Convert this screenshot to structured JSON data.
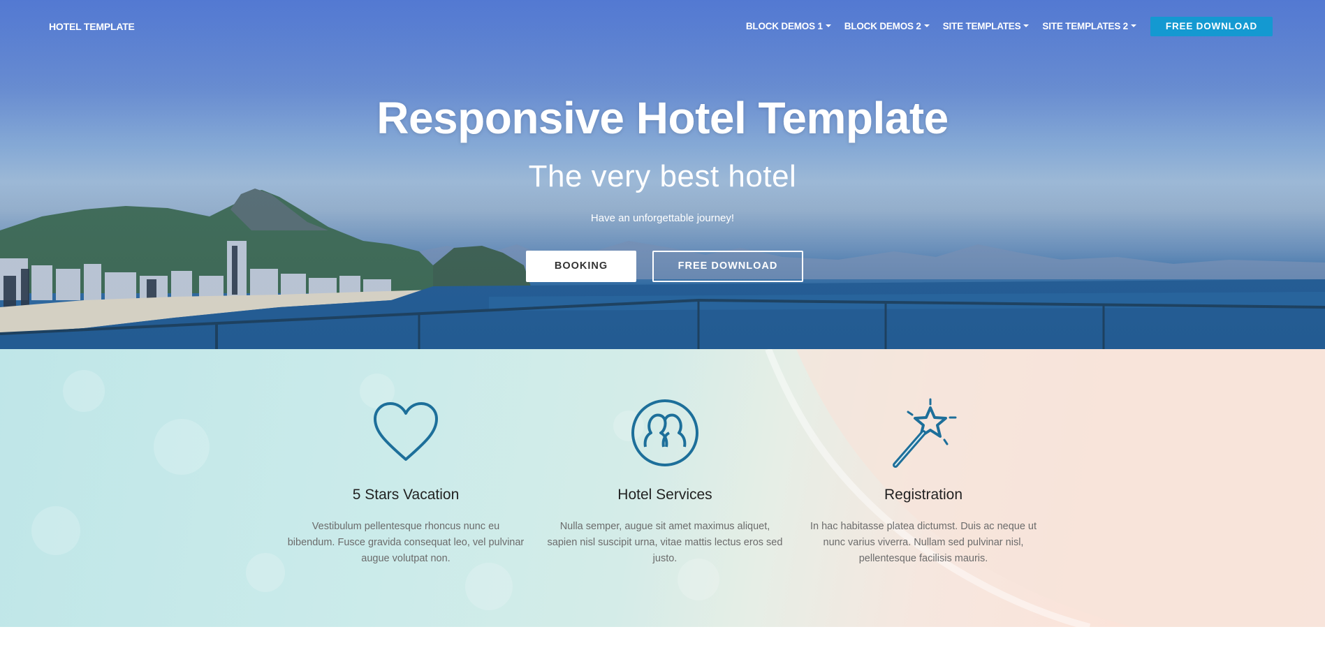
{
  "navbar": {
    "brand": "HOTEL TEMPLATE",
    "items": [
      {
        "label": "BLOCK DEMOS 1"
      },
      {
        "label": "BLOCK DEMOS 2"
      },
      {
        "label": "SITE TEMPLATES"
      },
      {
        "label": "SITE TEMPLATES 2"
      }
    ],
    "cta": "FREE DOWNLOAD"
  },
  "hero": {
    "title": "Responsive Hotel Template",
    "subtitle": "The very best hotel",
    "tagline": "Have an unforgettable journey!",
    "primary_button": "BOOKING",
    "secondary_button": "FREE DOWNLOAD"
  },
  "features": [
    {
      "icon": "heart-icon",
      "title": "5 Stars Vacation",
      "text": "Vestibulum pellentesque rhoncus nunc eu bibendum. Fusce gravida consequat leo, vel pulvinar augue volutpat non."
    },
    {
      "icon": "users-icon",
      "title": "Hotel Services",
      "text": "Nulla semper, augue sit amet maximus aliquet, sapien nisl suscipit urna, vitae mattis lectus eros sed justo."
    },
    {
      "icon": "magic-wand-icon",
      "title": "Registration",
      "text": "In hac habitasse platea dictumst. Duis ac neque ut nunc varius viverra. Nullam sed pulvinar nisl, pellentesque facilisis mauris."
    }
  ],
  "colors": {
    "accent": "#1499d1",
    "icon": "#1d6f9a",
    "hero_sky": "#5a7fd2"
  }
}
